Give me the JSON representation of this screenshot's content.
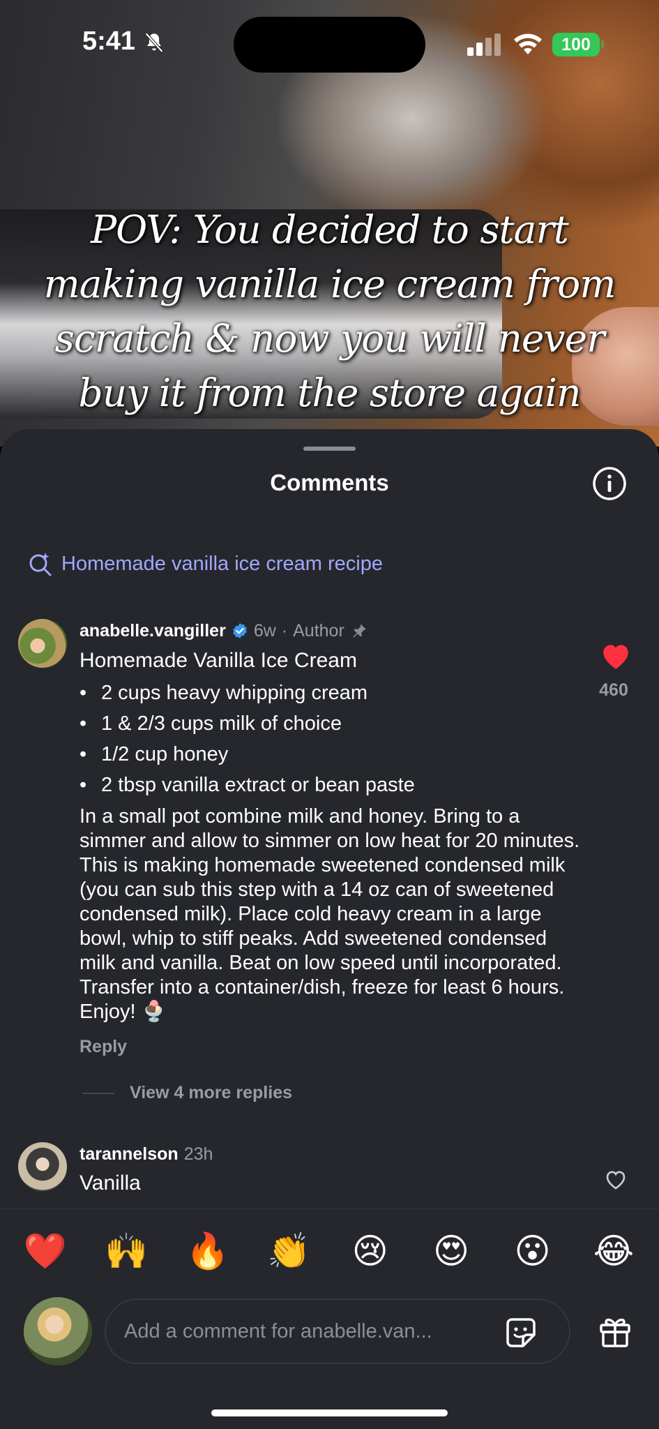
{
  "status_bar": {
    "time": "5:41",
    "battery": "100"
  },
  "video": {
    "caption": "POV: You decided to start making vanilla ice cream from scratch & now you will never buy it from the store again"
  },
  "sheet": {
    "title": "Comments"
  },
  "search_suggestion": {
    "label": "Homemade vanilla ice cream recipe"
  },
  "comments": [
    {
      "username": "anabelle.vangiller",
      "time": "6w",
      "tag": "Author",
      "title": "Homemade Vanilla Ice Cream",
      "bullets": [
        "2 cups heavy whipping cream",
        "1 & 2/3 cups milk of choice",
        "1/2 cup honey",
        "2 tbsp vanilla extract or bean paste"
      ],
      "body": "In a small pot combine milk and honey. Bring to a simmer and allow to simmer on low heat for 20 minutes. This is making homemade sweetened condensed milk (you can sub this step with a 14 oz can of sweetened condensed milk). Place cold heavy cream in a large bowl, whip to stiff peaks. Add sweetened condensed milk and vanilla. Beat on low speed until incorporated. Transfer into a container/dish, freeze for least 6 hours. Enjoy! 🍨",
      "reply_label": "Reply",
      "likes": "460",
      "liked": true,
      "more_replies": "View 4 more replies"
    },
    {
      "username": "tarannelson",
      "time": "23h",
      "text": "Vanilla",
      "liked": false
    }
  ],
  "quick_emojis": [
    "❤️",
    "🙌",
    "🔥",
    "👏",
    "😢",
    "😍",
    "😮",
    "😂"
  ],
  "composer": {
    "placeholder": "Add a comment for anabelle.van..."
  },
  "colors": {
    "sheet_bg": "#25272c",
    "accent_link": "#a3a6ff",
    "like_red": "#ff3040",
    "battery_green": "#34c759",
    "verified_blue": "#3897f0"
  }
}
